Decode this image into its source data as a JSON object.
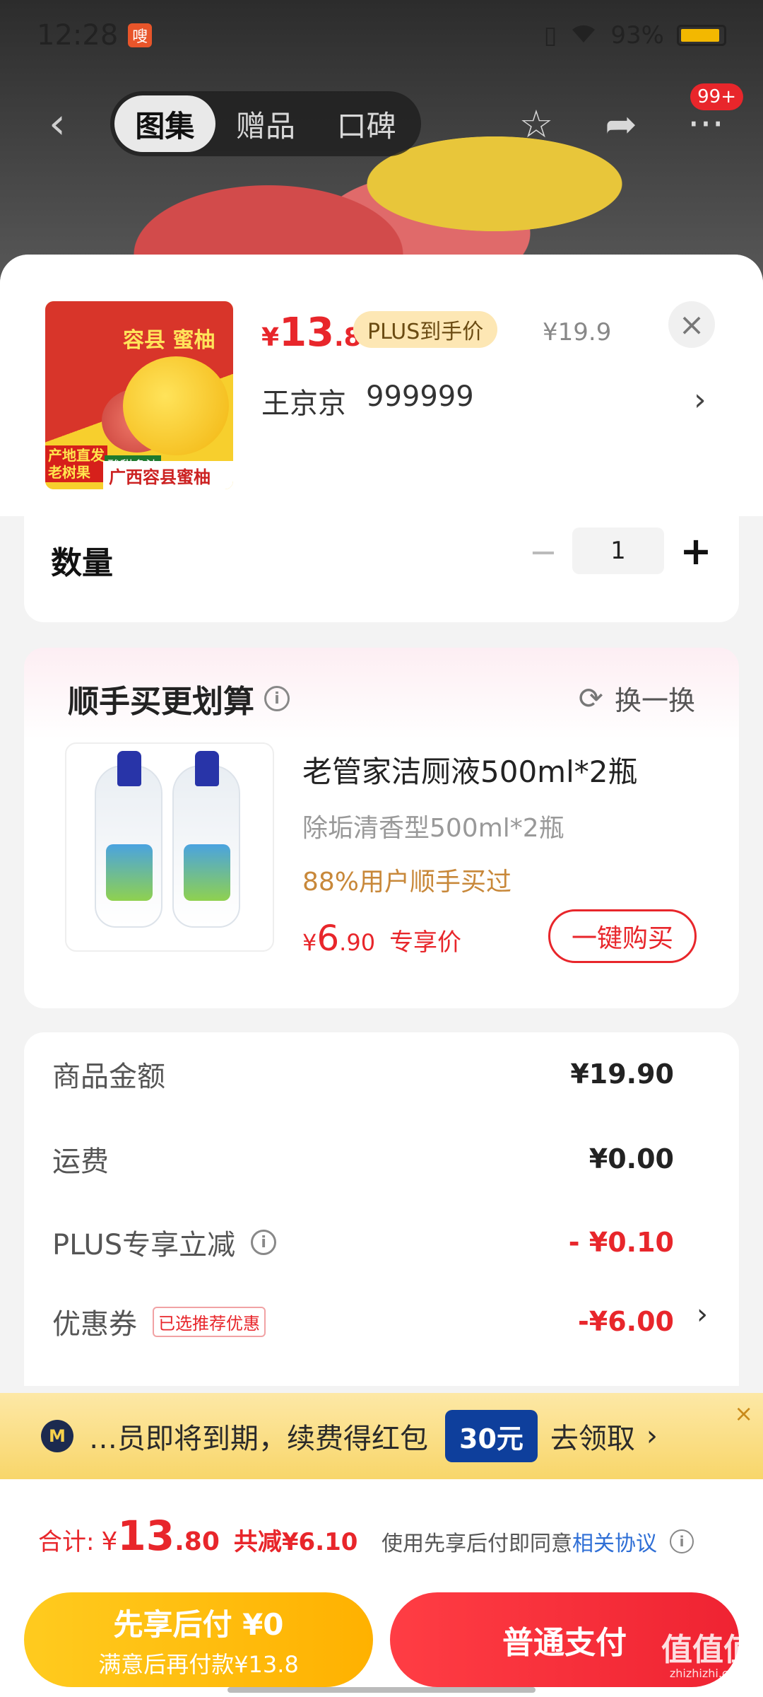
{
  "status_bar": {
    "time": "12:28",
    "app_icon_text": "嗖",
    "battery_text": "93%"
  },
  "nav": {
    "tabs": [
      "图集",
      "赠品",
      "口碑"
    ],
    "active_tab": 0,
    "badge": "99+",
    "icons": [
      "back-icon",
      "star-icon",
      "share-icon",
      "more-icon"
    ]
  },
  "product": {
    "price_symbol": "¥",
    "price_int": "13",
    "price_dec": ".8",
    "plus_tag": "PLUS到手价",
    "original_price": "¥19.9",
    "seller_name": "王京京",
    "seller_id": "999999",
    "image_text": {
      "title": "容县 蜜柚",
      "tag1_line1": "产地直发",
      "tag1_line2": "老树果",
      "tag2": "酸甜多汁",
      "bottom": "广西容县蜜柚"
    }
  },
  "quantity": {
    "label": "数量",
    "value": "1",
    "minus": "−",
    "plus": "+"
  },
  "addon": {
    "title": "顺手买更划算",
    "swap_label": "换一换",
    "name": "老管家洁厕液500ml*2瓶",
    "spec": "除垢清香型500ml*2瓶",
    "stat": "88%用户顺手买过",
    "price_symbol": "¥",
    "price_int": "6",
    "price_dec": ".90",
    "price_label": "专享价",
    "buy_label": "一键购买"
  },
  "summary": {
    "rows": [
      {
        "label": "商品金额",
        "value": "¥19.90"
      },
      {
        "label": "运费",
        "value": "¥0.00"
      },
      {
        "label": "PLUS专享立减",
        "value": "- ¥0.10"
      },
      {
        "label": "优惠券",
        "tag": "已选推荐优惠",
        "value": "-¥6.00"
      }
    ]
  },
  "promo": {
    "icon_text": "M",
    "text": "…员即将到期，续费得红包",
    "amount": "30元",
    "cta": "去领取",
    "close": "×"
  },
  "footer": {
    "total_label": "合计:",
    "total_symbol": "¥",
    "total_int": "13",
    "total_dec": ".80",
    "total_saved": "共减¥6.10",
    "agree_text": "使用先享后付即同意",
    "agree_link": "相关协议",
    "later_line1": "先享后付 ¥0",
    "later_line2": "满意后再付款¥13.8",
    "pay_label": "普通支付"
  },
  "watermark": {
    "line1": "值值值",
    "line2": "zhizhizhi.com"
  },
  "colors": {
    "accent_red": "#e8262b",
    "plus_tag_bg": "#fde7b4",
    "promo_blue": "#0e3f9c",
    "later_yellow": "#ffb100"
  }
}
